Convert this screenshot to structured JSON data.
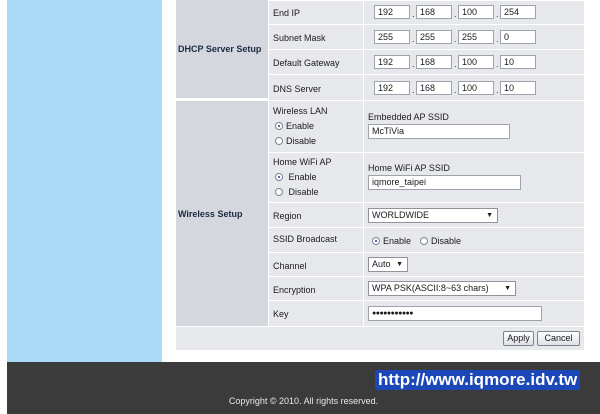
{
  "dhcp": {
    "section_label": "DHCP Server Setup",
    "end_ip": {
      "label": "End IP",
      "octets": [
        "192",
        "168",
        "100",
        "254"
      ]
    },
    "subnet_mask": {
      "label": "Subnet Mask",
      "octets": [
        "255",
        "255",
        "255",
        "0"
      ]
    },
    "default_gateway": {
      "label": "Default Gateway",
      "octets": [
        "192",
        "168",
        "100",
        "10"
      ]
    },
    "dns_server": {
      "label": "DNS Server",
      "octets": [
        "192",
        "168",
        "100",
        "10"
      ]
    }
  },
  "wireless": {
    "section_label": "Wireless Setup",
    "wireless_lan": {
      "label": "Wireless LAN",
      "enable": "Enable",
      "disable": "Disable",
      "selected": "Enable",
      "ssid_label": "Embedded AP SSID",
      "ssid_value": "McTiVia"
    },
    "home_wifi": {
      "label": "Home WiFi AP",
      "enable": "Enable",
      "disable": "Disable",
      "selected": "Enable",
      "ssid_label": "Home WiFi AP SSID",
      "ssid_value": "iqmore_taipei"
    },
    "region": {
      "label": "Region",
      "value": "WORLDWIDE"
    },
    "ssid_broadcast": {
      "label": "SSID Broadcast",
      "enable": "Enable",
      "disable": "Disable",
      "selected": "Enable"
    },
    "channel": {
      "label": "Channel",
      "value": "Auto"
    },
    "encryption": {
      "label": "Encryption",
      "value": "WPA PSK(ASCII:8~63 chars)"
    },
    "key": {
      "label": "Key",
      "value": "●●●●●●●●●●●"
    }
  },
  "buttons": {
    "apply": "Apply",
    "cancel": "Cancel"
  },
  "footer": {
    "url": "http://www.iqmore.idv.tw",
    "copyright": "Copyright © 2010. All rights reserved."
  },
  "colors": {
    "sidebar": "#a9dbf7",
    "footer": "#3b3b3b",
    "section": "#d4d7dd",
    "row": "#e7e8ec",
    "url_bg": "#1c47b8"
  }
}
